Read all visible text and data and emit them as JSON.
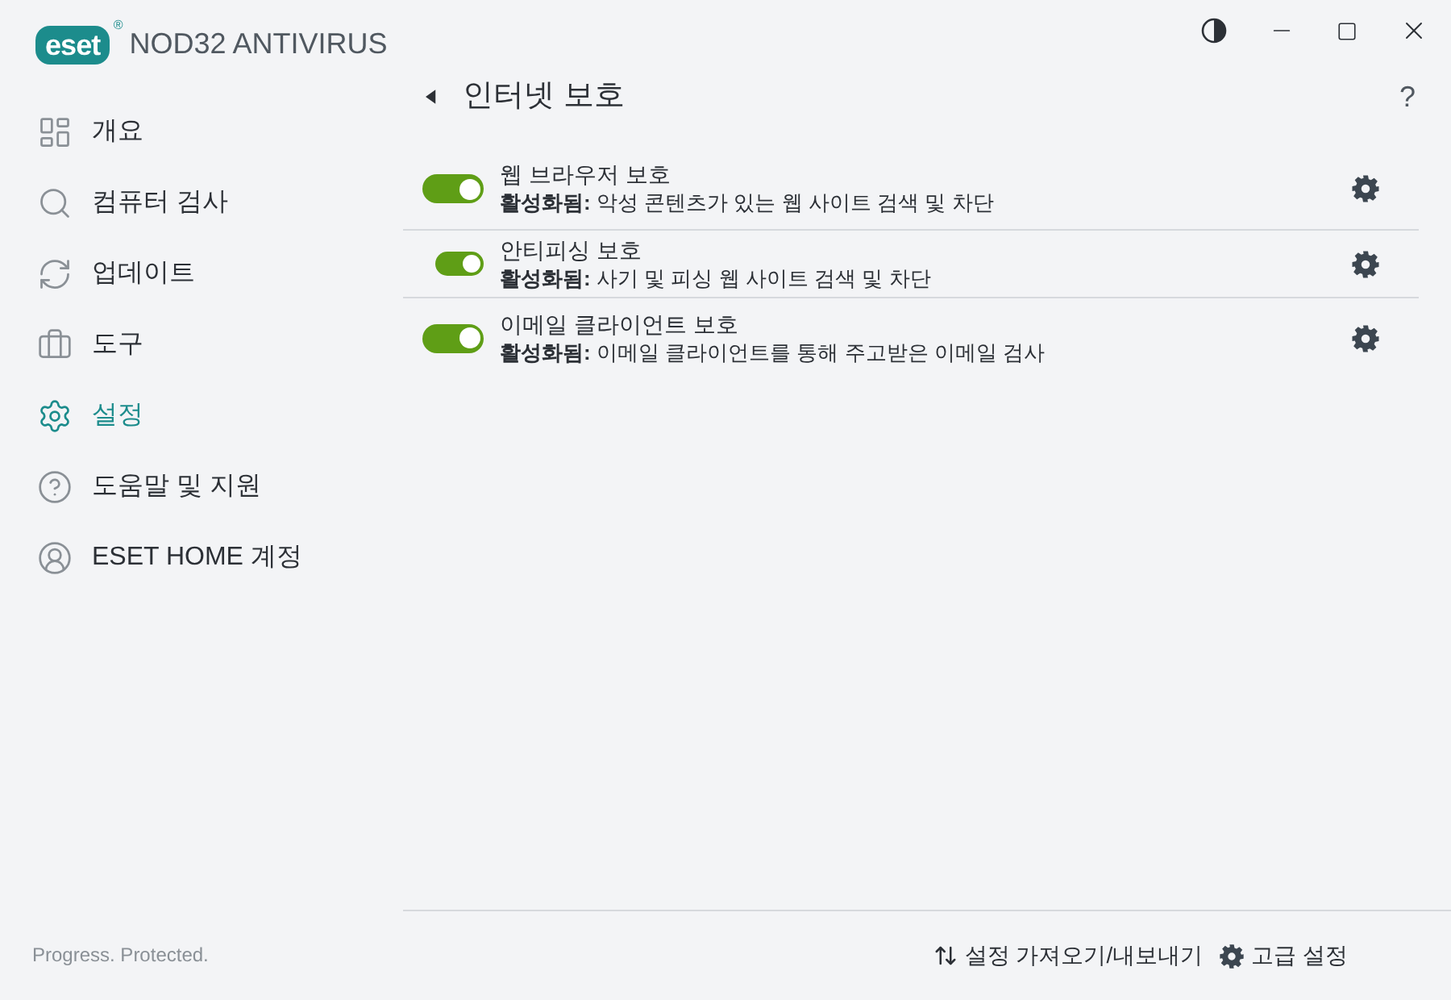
{
  "logo": {
    "mark": "eset",
    "registered": "®",
    "product": "NOD32 ANTIVIRUS"
  },
  "sidebar": {
    "items": [
      {
        "label": "개요",
        "selected": false
      },
      {
        "label": "컴퓨터 검사",
        "selected": false
      },
      {
        "label": "업데이트",
        "selected": false
      },
      {
        "label": "도구",
        "selected": false
      },
      {
        "label": "설정",
        "selected": true
      },
      {
        "label": "도움말 및 지원",
        "selected": false
      },
      {
        "label": "ESET HOME 계정",
        "selected": false
      }
    ],
    "footer": "Progress. Protected."
  },
  "page": {
    "title": "인터넷 보호",
    "help": "?"
  },
  "features": [
    {
      "name": "웹 브라우저 보호",
      "status_label": "활성화됨:",
      "description": "악성 콘텐츠가 있는 웹 사이트 검색 및 차단",
      "on": true,
      "kind": "large"
    },
    {
      "name": "안티피싱 보호",
      "status_label": "활성화됨:",
      "description": "사기 및 피싱 웹 사이트 검색 및 차단",
      "on": true,
      "kind": "small"
    },
    {
      "name": "이메일 클라이언트 보호",
      "status_label": "활성화됨:",
      "description": "이메일 클라이언트를 통해 주고받은 이메일 검사",
      "on": true,
      "kind": "large"
    }
  ],
  "footer_buttons": [
    "설정 가져오기/내보내기",
    "고급 설정"
  ]
}
